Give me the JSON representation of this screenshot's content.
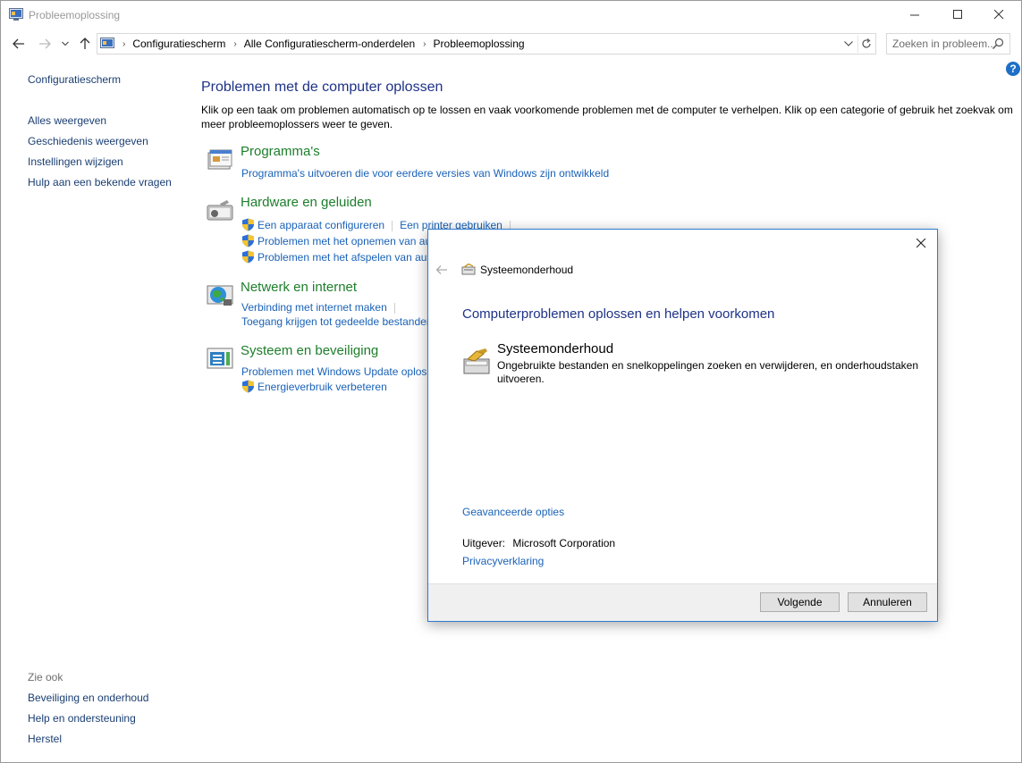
{
  "window": {
    "title": "Probleemoplossing",
    "minimize_glyph": "—",
    "maximize_glyph": "☐",
    "close_glyph": "✕"
  },
  "addressbar": {
    "breadcrumbs": [
      "Configuratiescherm",
      "Alle Configuratiescherm-onderdelen",
      "Probleemoplossing"
    ],
    "separator": "›"
  },
  "search": {
    "placeholder": "Zoeken in probleem..."
  },
  "leftnav": {
    "home": "Configuratiescherm",
    "items": [
      "Alles weergeven",
      "Geschiedenis weergeven",
      "Instellingen wijzigen",
      "Hulp aan een bekende vragen"
    ]
  },
  "seealso": {
    "title": "Zie ook",
    "items": [
      "Beveiliging en onderhoud",
      "Help en ondersteuning",
      "Herstel"
    ]
  },
  "main": {
    "heading": "Problemen met de computer oplossen",
    "description": "Klik op een taak om problemen automatisch op te lossen en vaak voorkomende problemen met de computer te verhelpen. Klik op een categorie of gebruik het zoekvak om meer probleemoplossers weer te geven.",
    "categories": [
      {
        "title": "Programma's",
        "links": [
          "Programma's uitvoeren die voor eerdere versies van Windows zijn ontwikkeld"
        ]
      },
      {
        "title": "Hardware en geluiden",
        "links": [
          "Een apparaat configureren",
          "Een printer gebruiken",
          "Problemen met het opnemen van au",
          "Problemen met het afspelen van au"
        ]
      },
      {
        "title": "Netwerk en internet",
        "links": [
          "Verbinding met internet maken",
          "Toegang krijgen tot gedeelde bestanden"
        ]
      },
      {
        "title": "Systeem en beveiliging",
        "links": [
          "Problemen met Windows Update oplos",
          "Energieverbruik verbeteren"
        ]
      }
    ]
  },
  "dialog": {
    "breadcrumb": "Systeemonderhoud",
    "heading": "Computerproblemen oplossen en helpen voorkomen",
    "item_title": "Systeemonderhoud",
    "item_description": "Ongebruikte bestanden en snelkoppelingen zoeken en verwijderen, en onderhoudstaken uitvoeren.",
    "advanced": "Geavanceerde opties",
    "publisher_label": "Uitgever:",
    "publisher_value": "Microsoft Corporation",
    "privacy": "Privacyverklaring",
    "next_button": "Volgende",
    "cancel_button": "Annuleren"
  },
  "colors": {
    "heading_blue": "#1e3287",
    "link_blue": "#1a62b8",
    "category_green": "#1d7e2b",
    "dialog_border": "#2e7bd0"
  }
}
